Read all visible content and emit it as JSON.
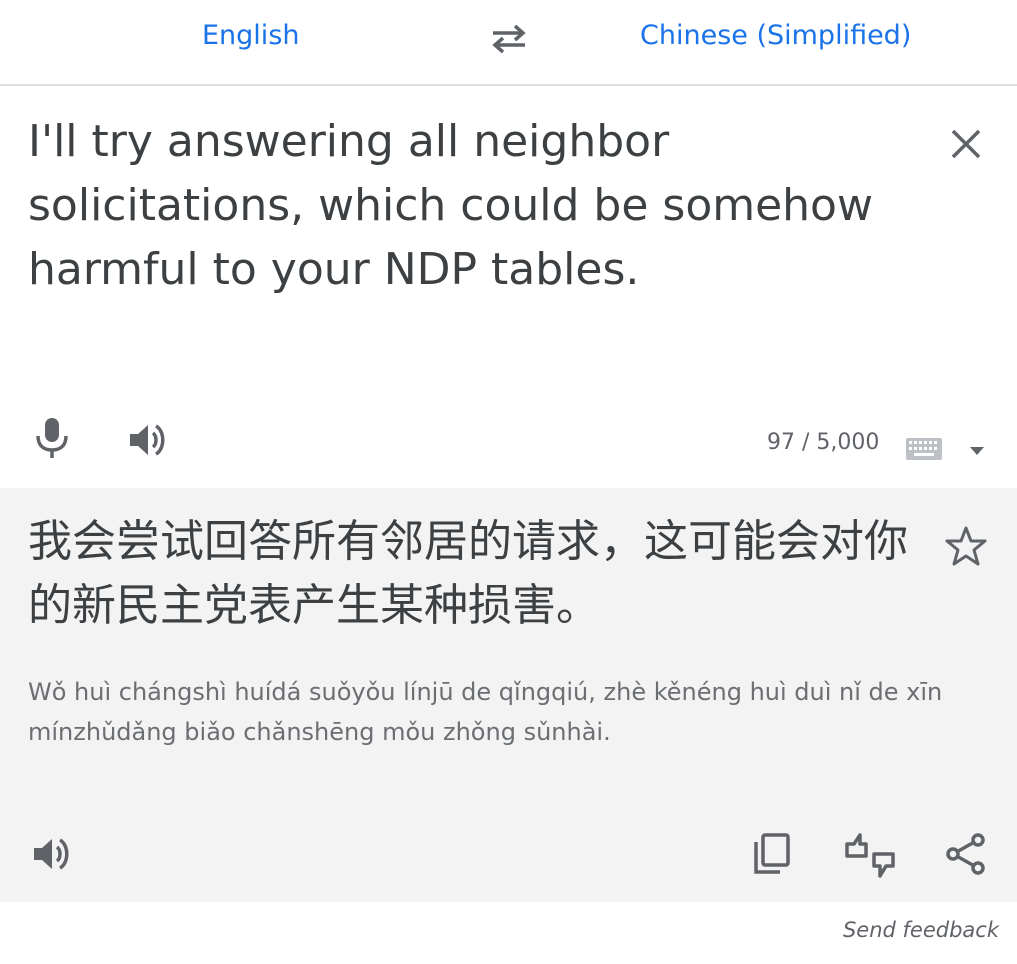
{
  "lang_bar": {
    "source_lang": "English",
    "target_lang": "Chinese (Simplified)"
  },
  "source": {
    "text": "I'll try answering all neighbor solicitations, which could be somehow harmful to your NDP tables.",
    "char_count": "97 / 5,000"
  },
  "target": {
    "text": "我会尝试回答所有邻居的请求，这可能会对你的新民主党表产生某种损害。",
    "pinyin": "Wǒ huì chángshì huídá suǒyǒu línjū de qǐngqiú, zhè kěnéng huì duì nǐ de xīn mínzhǔdǎng biǎo chǎnshēng mǒu zhǒng sǔnhài."
  },
  "footer": {
    "feedback_label": "Send feedback"
  },
  "colors": {
    "accent": "#1a73e8",
    "text": "#3c4043",
    "icon": "#5f6368",
    "target_bg": "#f3f3f3"
  }
}
